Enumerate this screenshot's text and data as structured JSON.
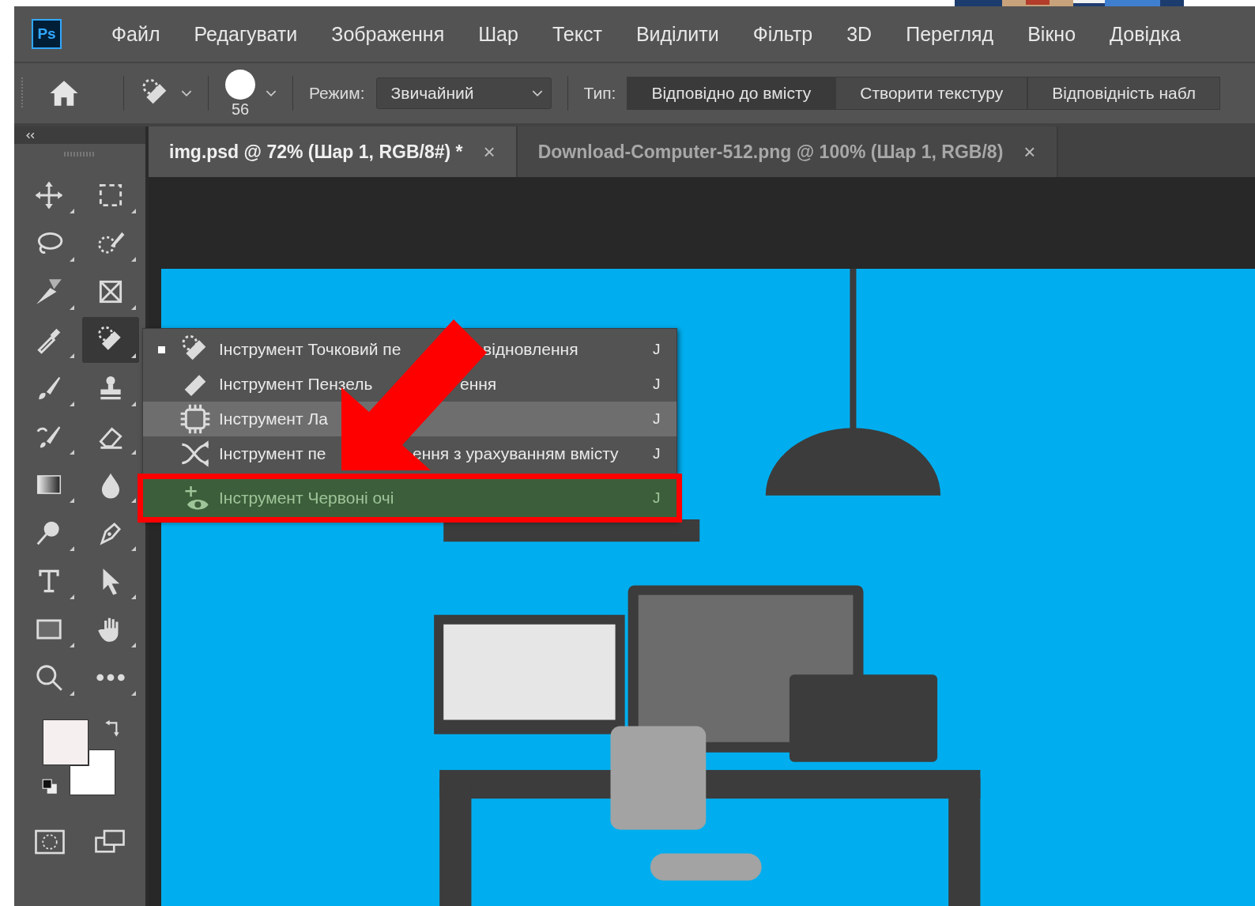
{
  "app_logo": "Ps",
  "menu_bar": [
    "Файл",
    "Редагувати",
    "Зображення",
    "Шар",
    "Текст",
    "Виділити",
    "Фільтр",
    "3D",
    "Перегляд",
    "Вікно",
    "Довідка"
  ],
  "options_bar": {
    "brush_size": "56",
    "mode_label": "Режим:",
    "mode_value": "Звичайний",
    "type_label": "Тип:",
    "type_options": [
      {
        "label": "Відповідно до вмісту",
        "selected": true
      },
      {
        "label": "Створити текстуру",
        "selected": false
      },
      {
        "label": "Відповідність набл",
        "selected": false
      }
    ]
  },
  "document_tabs": [
    {
      "title": "img.psd @ 72% (Шар 1, RGB/8#) *",
      "close": "×",
      "selected": true
    },
    {
      "title": "Download-Computer-512.png @ 100% (Шар 1, RGB/8)",
      "close": "×",
      "selected": false
    }
  ],
  "tools": [
    {
      "selected": false
    },
    {
      "selected": false
    },
    {
      "selected": false
    },
    {
      "selected": false
    },
    {
      "selected": false
    },
    {
      "selected": false
    },
    {
      "selected": false
    },
    {
      "selected": true
    },
    {
      "selected": false
    },
    {
      "selected": false
    },
    {
      "selected": false
    },
    {
      "selected": false
    },
    {
      "selected": false
    },
    {
      "selected": false
    },
    {
      "selected": false
    },
    {
      "selected": false
    },
    {
      "selected": false
    },
    {
      "selected": false
    },
    {
      "selected": false
    },
    {
      "selected": false
    },
    {
      "selected": false
    },
    {
      "selected": false
    }
  ],
  "tool_flyout": [
    {
      "label_parts": [
        "Інструмент Точковий пе",
        "відновлення"
      ],
      "shortcut": "J",
      "current": true,
      "hovered": false,
      "highlighted": false
    },
    {
      "label_parts": [
        "Інструмент Пензель",
        "ення"
      ],
      "shortcut": "J",
      "current": false,
      "hovered": false,
      "highlighted": false
    },
    {
      "label_parts": [
        "Інструмент Ла"
      ],
      "shortcut": "J",
      "current": false,
      "hovered": true,
      "highlighted": false
    },
    {
      "label_parts": [
        "Інструмент пе",
        "ення з урахуванням вмісту"
      ],
      "shortcut": "J",
      "current": false,
      "hovered": false,
      "highlighted": false
    },
    {
      "label_parts": [
        "Інструмент Червоні очі"
      ],
      "shortcut": "J",
      "current": false,
      "hovered": false,
      "highlighted": true
    }
  ]
}
